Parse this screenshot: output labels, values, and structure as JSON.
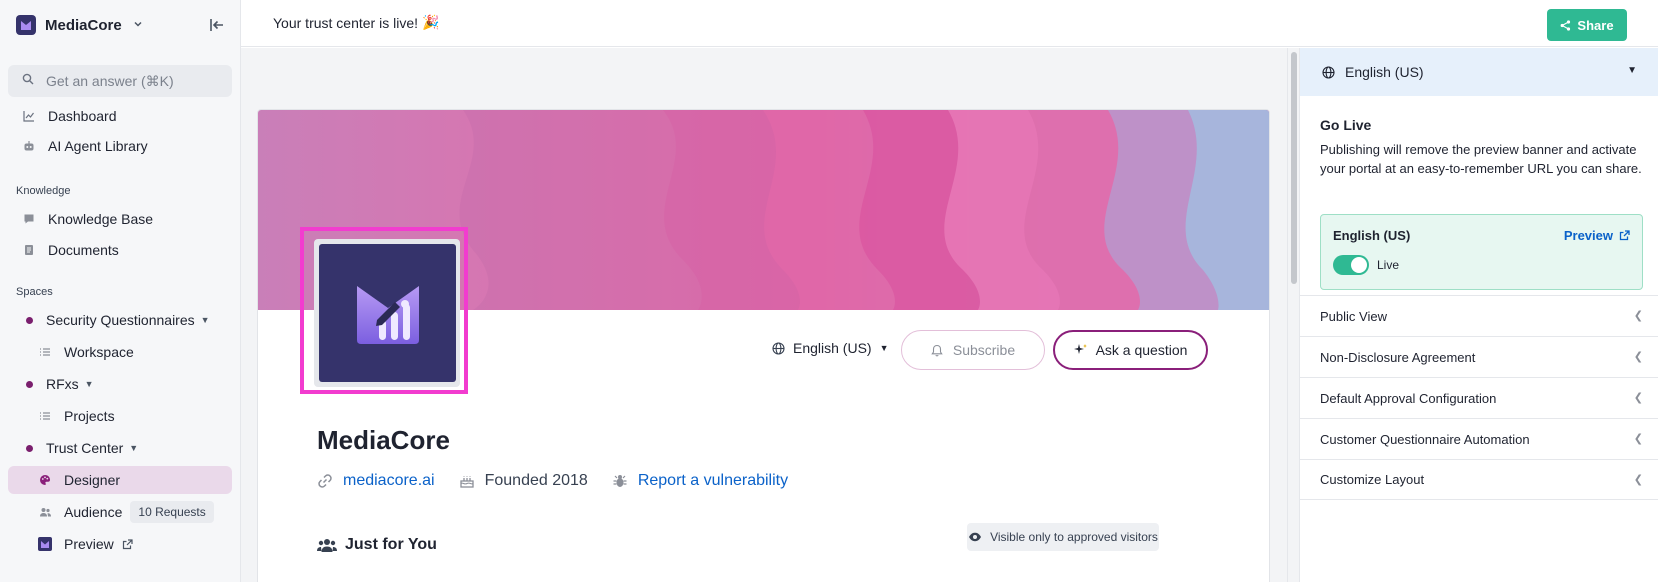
{
  "sidebar": {
    "brand": "MediaCore",
    "search_placeholder": "Get an answer (⌘K)",
    "items": {
      "dashboard": "Dashboard",
      "ai_agent_library": "AI Agent Library",
      "knowledge_base": "Knowledge Base",
      "documents": "Documents",
      "security_questionnaires": "Security Questionnaires",
      "workspace": "Workspace",
      "rfxs": "RFxs",
      "projects": "Projects",
      "trust_center": "Trust Center",
      "designer": "Designer",
      "audience": "Audience",
      "audience_badge": "10 Requests",
      "preview": "Preview"
    },
    "sections": {
      "knowledge": "Knowledge",
      "spaces": "Spaces"
    }
  },
  "topbar": {
    "banner": "Your trust center is live!",
    "banner_emoji": "🎉",
    "share_label": "Share"
  },
  "trust_page": {
    "language": "English (US)",
    "subscribe_label": "Subscribe",
    "ask_label": "Ask a question",
    "company_name": "MediaCore",
    "website": "mediacore.ai",
    "founded": "Founded 2018",
    "report_vulnerability": "Report a vulnerability",
    "just_for_you": "Just for You",
    "visible_note": "Visible only to approved visitors"
  },
  "right_panel": {
    "language": "English (US)",
    "go_live_title": "Go Live",
    "go_live_desc": "Publishing will remove the preview banner and activate your portal at an easy-to-remember URL you can share.",
    "live_card": {
      "language": "English (US)",
      "preview_label": "Preview",
      "toggle_label": "Live",
      "toggle_on": true
    },
    "sections": [
      "Public View",
      "Non-Disclosure Agreement",
      "Default Approval Configuration",
      "Customer Questionnaire Automation",
      "Customize Layout"
    ]
  },
  "colors": {
    "accent_green": "#2fb993",
    "brand_purple": "#35336b",
    "trust_magenta": "#8a1f7a",
    "link_blue": "#0b62c9",
    "highlight_pink": "#f23ccf"
  }
}
